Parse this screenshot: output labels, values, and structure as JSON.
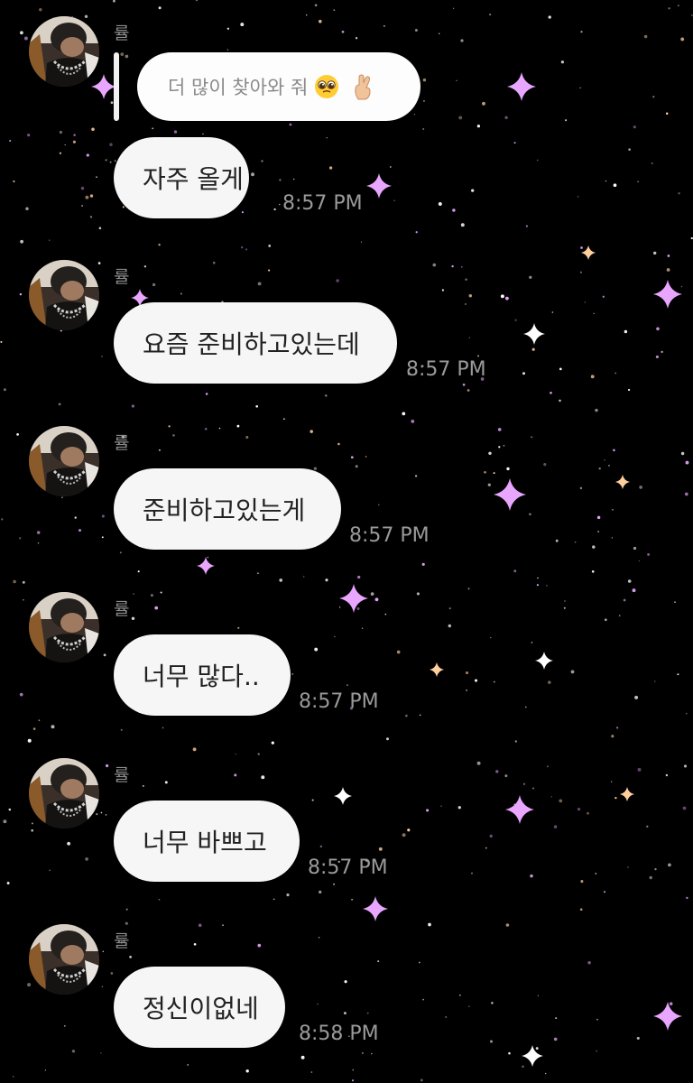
{
  "reply": {
    "quoted_text": "더 많이 찾아와 줘",
    "emojis": [
      "pleading-face-emoji",
      "crossed-fingers-emoji"
    ]
  },
  "messages": [
    {
      "sender": "률",
      "text": "자주 올게",
      "time": "8:57 PM"
    },
    {
      "sender": "률",
      "text": "요즘 준비하고있는데",
      "time": "8:57 PM"
    },
    {
      "sender": "률",
      "text": "준비하고있는게",
      "time": "8:57 PM"
    },
    {
      "sender": "률",
      "text": "너무 많다..",
      "time": "8:57 PM"
    },
    {
      "sender": "률",
      "text": "너무 바쁘고",
      "time": "8:57 PM"
    },
    {
      "sender": "률",
      "text": "정신이없네",
      "time": "8:58 PM"
    }
  ],
  "colors": {
    "background": "#000000",
    "bubble": "#f6f6f6",
    "timestamp": "#9a9a9a",
    "sparkle_pink": "#e9a6ff",
    "sparkle_white": "#ffffff"
  }
}
